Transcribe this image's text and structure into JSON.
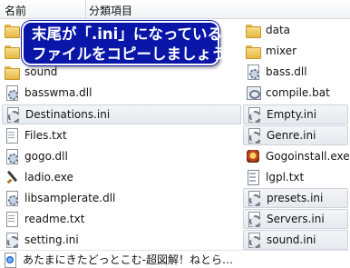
{
  "header": {
    "name_label": "名前",
    "type_label": "分類項目"
  },
  "left_files": [
    {
      "name": "",
      "icon": "folder-icon",
      "kind": "folder"
    },
    {
      "name": "",
      "icon": "folder-icon",
      "kind": "folder"
    },
    {
      "name": "sound",
      "icon": "folder-icon",
      "kind": "folder"
    },
    {
      "name": "basswma.dll",
      "icon": "dll-file-icon",
      "kind": "dll"
    },
    {
      "name": "Destinations.ini",
      "icon": "ini-file-icon",
      "kind": "ini",
      "selected": true
    },
    {
      "name": "Files.txt",
      "icon": "text-file-icon",
      "kind": "txt"
    },
    {
      "name": "gogo.dll",
      "icon": "dll-file-icon",
      "kind": "dll"
    },
    {
      "name": "ladio.exe",
      "icon": "pen-exe-icon",
      "kind": "exe-pen"
    },
    {
      "name": "libsamplerate.dll",
      "icon": "dll-file-icon",
      "kind": "dll"
    },
    {
      "name": "readme.txt",
      "icon": "text-file-icon",
      "kind": "txt"
    },
    {
      "name": "setting.ini",
      "icon": "ini-file-icon",
      "kind": "ini"
    }
  ],
  "right_files": [
    {
      "name": "data",
      "icon": "folder-icon",
      "kind": "folder"
    },
    {
      "name": "mixer",
      "icon": "folder-icon",
      "kind": "folder"
    },
    {
      "name": "bass.dll",
      "icon": "dll-file-icon",
      "kind": "dll"
    },
    {
      "name": "compile.bat",
      "icon": "batch-file-icon",
      "kind": "bat"
    },
    {
      "name": "Empty.ini",
      "icon": "ini-file-icon",
      "kind": "ini",
      "selected": true
    },
    {
      "name": "Genre.ini",
      "icon": "ini-file-icon",
      "kind": "ini",
      "selected": true
    },
    {
      "name": "Gogoinstall.exe",
      "icon": "gogo-exe-icon",
      "kind": "exe-go"
    },
    {
      "name": "lgpl.txt",
      "icon": "text-file-icon",
      "kind": "unknown"
    },
    {
      "name": "presets.ini",
      "icon": "ini-file-icon",
      "kind": "ini",
      "selected": true
    },
    {
      "name": "Servers.ini",
      "icon": "ini-file-icon",
      "kind": "ini",
      "selected": true
    },
    {
      "name": "sound.ini",
      "icon": "ini-file-icon",
      "kind": "ini",
      "selected": true
    }
  ],
  "callout": {
    "line1": "末尾が「.ini」になっている",
    "line2": "ファイルをコピーしましょう"
  },
  "status": {
    "text": "あたまにきたどっとこむ-超図解！ねとら…"
  },
  "colors": {
    "callout_bg": "#0a16a8",
    "selection_border": "#cdd3da"
  }
}
